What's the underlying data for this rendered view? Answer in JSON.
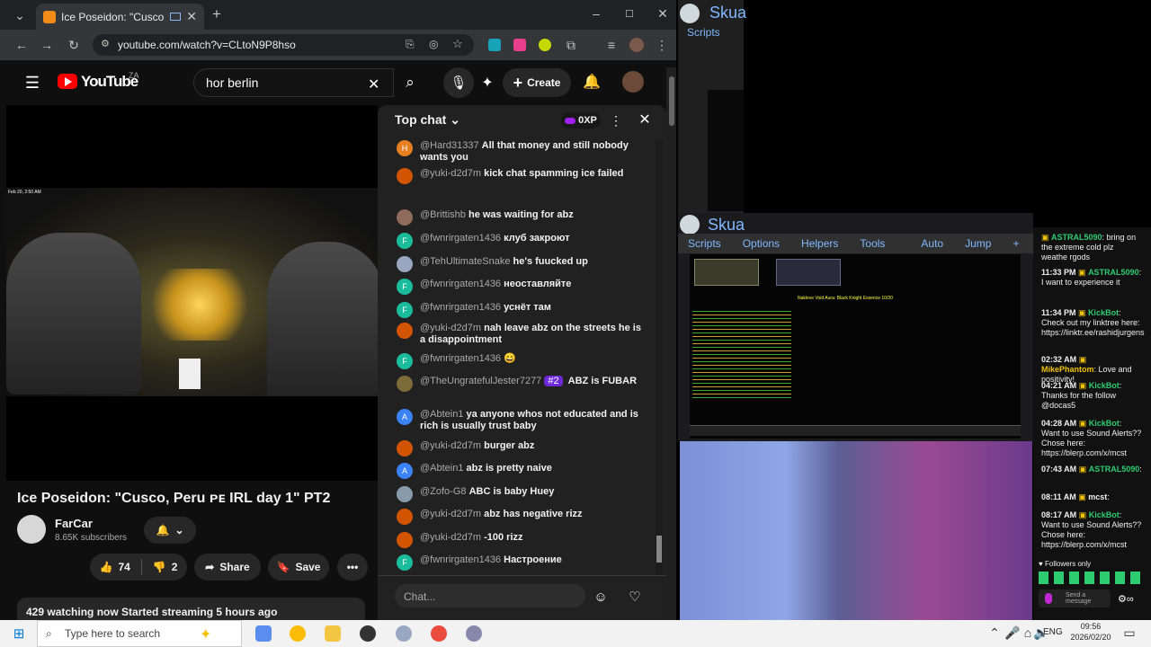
{
  "browser": {
    "tab_title": "Ice Poseidon: \"Cusco, Peru",
    "url": "youtube.com/watch?v=CLtoN9P8hso"
  },
  "youtube": {
    "region": "ZA",
    "logo_text": "YouTube",
    "search_value": "hor berlin",
    "create_label": "Create",
    "video_title": "Ice Poseidon: \"Cusco, Peru ᴘᴇ IRL day 1\" PT2",
    "channel": "FarCar",
    "subscribers": "8.65K subscribers",
    "likes": "74",
    "dislikes": "2",
    "share_label": "Share",
    "save_label": "Save",
    "watching": "429 watching now  Started streaming 5 hours ago",
    "video_timestamp": "Feb 20, 2:50 AM"
  },
  "chat": {
    "header": "Top chat",
    "xp": "0XP",
    "input_placeholder": "Chat...",
    "messages": [
      {
        "author": "@Hard31337",
        "text": "All that money and still nobody wants you",
        "color": "#e67e22",
        "initial": "H"
      },
      {
        "author": "@yuki-d2d7m",
        "text": "kick chat spamming ice failed",
        "color": "#d35400",
        "initial": ""
      },
      {
        "author": "@Brittishb",
        "text": "he was waiting for abz",
        "color": "#8e6b5a",
        "initial": ""
      },
      {
        "author": "@fwnrirgaten1436",
        "text": "клуб закроют",
        "color": "#1abc9c",
        "initial": "F"
      },
      {
        "author": "@TehUltimateSnake",
        "text": "he's fuucked up",
        "color": "#9aa7c0",
        "initial": ""
      },
      {
        "author": "@fwnrirgaten1436",
        "text": "неоставляйте",
        "color": "#1abc9c",
        "initial": "F"
      },
      {
        "author": "@fwnrirgaten1436",
        "text": "уснёт там",
        "color": "#1abc9c",
        "initial": "F"
      },
      {
        "author": "@yuki-d2d7m",
        "text": "nah leave abz on the streets he is a disappointment",
        "color": "#d35400",
        "initial": ""
      },
      {
        "author": "@fwnrirgaten1436",
        "text": "😄",
        "color": "#1abc9c",
        "initial": "F"
      },
      {
        "author": "@TheUngratefulJester7277",
        "text": "ABZ is FUBAR",
        "color": "#7d6b3a",
        "initial": "",
        "badge": "#2"
      },
      {
        "author": "@Abtein1",
        "text": "ya anyone whos not educated and is rich is usually trust baby",
        "color": "#3b82f6",
        "initial": "A"
      },
      {
        "author": "@yuki-d2d7m",
        "text": "burger abz",
        "color": "#d35400",
        "initial": ""
      },
      {
        "author": "@Abtein1",
        "text": "abz is pretty naive",
        "color": "#3b82f6",
        "initial": "A"
      },
      {
        "author": "@Zofo-G8",
        "text": "ABC is baby Huey",
        "color": "#8899aa",
        "initial": ""
      },
      {
        "author": "@yuki-d2d7m",
        "text": "abz has negative rizz",
        "color": "#d35400",
        "initial": ""
      },
      {
        "author": "@yuki-d2d7m",
        "text": "-100 rizz",
        "color": "#d35400",
        "initial": ""
      },
      {
        "author": "@fwnrirgaten1436",
        "text": "Настроение",
        "color": "#1abc9c",
        "initial": "F"
      }
    ]
  },
  "skua": {
    "title": "Skua",
    "scripts": "Scripts",
    "menu": [
      "Scripts",
      "Options",
      "Helpers",
      "Tools",
      "Auto",
      "Jump",
      "+"
    ],
    "game_banner": "Nakleve Void Aura: Black Knight Essence 10/20"
  },
  "twitch": {
    "lines": [
      {
        "time": "",
        "name": "ASTRAL5090",
        "text": ": bring on the extreme cold plz weathe rgods",
        "color": "#2ecc71"
      },
      {
        "time": "11:33 PM",
        "name": "ASTRAL5090",
        "text": ": I want to experience it",
        "color": "#2ecc71"
      },
      {
        "time": "11:34 PM",
        "name": "KickBot",
        "text": ": Check out my linktree here: https://linktr.ee/rashidjurgens",
        "color": "#2ecc71"
      },
      {
        "time": "02:32 AM",
        "name": "MikePhantom",
        "text": ": Love and positivity!",
        "color": "#f1c40f"
      },
      {
        "time": "04:21 AM",
        "name": "KickBot",
        "text": ": Thanks for the follow @docas5",
        "color": "#2ecc71"
      },
      {
        "time": "04:28 AM",
        "name": "KickBot",
        "text": ": Want to use Sound Alerts?? Chose here: https://blerp.com/x/mcst",
        "color": "#2ecc71"
      },
      {
        "time": "07:43 AM",
        "name": "ASTRAL5090",
        "text": ":",
        "color": "#2ecc71"
      },
      {
        "time": "08:11 AM",
        "name": "mcst",
        "text": ":",
        "color": "#efeff1"
      },
      {
        "time": "08:17 AM",
        "name": "KickBot",
        "text": ": Want to use Sound Alerts?? Chose here: https://blerp.com/x/mcst",
        "color": "#2ecc71"
      }
    ],
    "followers_only": "Followers only",
    "send_placeholder": "Send a message"
  },
  "taskbar": {
    "search_placeholder": "Type here to search",
    "lang": "ENG",
    "time": "09:56",
    "date": "2026/02/20"
  }
}
